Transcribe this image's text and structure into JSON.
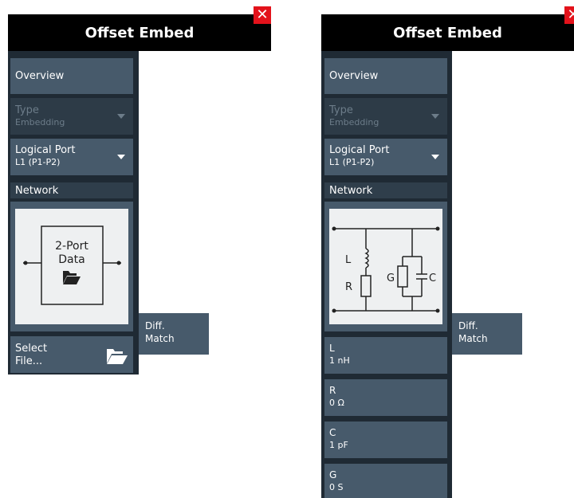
{
  "left_panel": {
    "title": "Offset Embed",
    "close_glyph": "✕",
    "overview": "Overview",
    "type": {
      "label": "Type",
      "value": "Embedding"
    },
    "logical_port": {
      "label": "Logical Port",
      "value": "L1 (P1-P2)"
    },
    "network_section": "Network",
    "diagram_label_line1": "2-Port",
    "diagram_label_line2": "Data",
    "diagram_icon": "folder-open-icon",
    "select_file": {
      "line1": "Select",
      "line2": "File...",
      "icon": "folder-open-icon"
    },
    "diff_match": {
      "line1": "Diff.",
      "line2": "Match"
    }
  },
  "right_panel": {
    "title": "Offset Embed",
    "close_glyph": "✕",
    "overview": "Overview",
    "type": {
      "label": "Type",
      "value": "Embedding"
    },
    "logical_port": {
      "label": "Logical Port",
      "value": "L1 (P1-P2)"
    },
    "network_section": "Network",
    "circuit_labels": {
      "L": "L",
      "R": "R",
      "G": "G",
      "C": "C"
    },
    "params": [
      {
        "name": "L",
        "value": "1 nH"
      },
      {
        "name": "R",
        "value": "0 Ω"
      },
      {
        "name": "C",
        "value": "1 pF"
      },
      {
        "name": "G",
        "value": "0 S"
      }
    ],
    "diff_match": {
      "line1": "Diff.",
      "line2": "Match"
    }
  },
  "colors": {
    "title_bg": "#000000",
    "close_bg": "#e3121b",
    "button_bg": "#475a6b",
    "button_disabled_bg": "#2d3b47",
    "sidebar_bg": "#1f2a34",
    "diagram_bg": "#eef0f1"
  }
}
